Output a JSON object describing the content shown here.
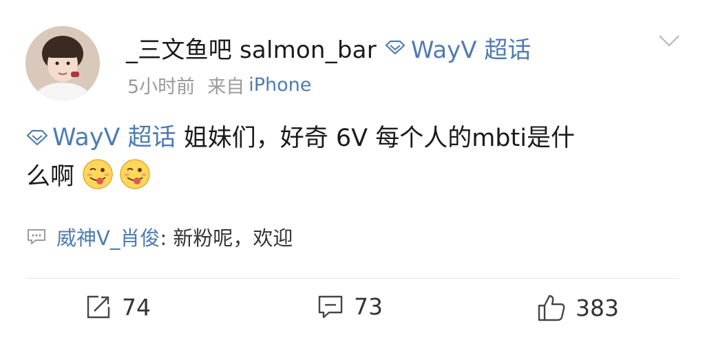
{
  "post": {
    "username": "_三文鱼吧 salmon_bar",
    "topic_tag": "WayV 超话",
    "time": "5小时前",
    "source_prefix": "来自",
    "source": "iPhone",
    "body_tag": "WayV 超话",
    "body_text_line1": " 姐妹们，好奇 6V 每个人的mbti是什",
    "body_text_line2": "么啊",
    "emoji_names": [
      "yummy-face-icon",
      "yummy-face-icon"
    ]
  },
  "comment": {
    "user": "威神V_肖俊",
    "text": ": 新粉呢，欢迎"
  },
  "actions": {
    "repost_count": "74",
    "comment_count": "73",
    "like_count": "383"
  },
  "colors": {
    "link_blue": "#4f7bb0",
    "meta_gray": "#9a9a9a"
  }
}
